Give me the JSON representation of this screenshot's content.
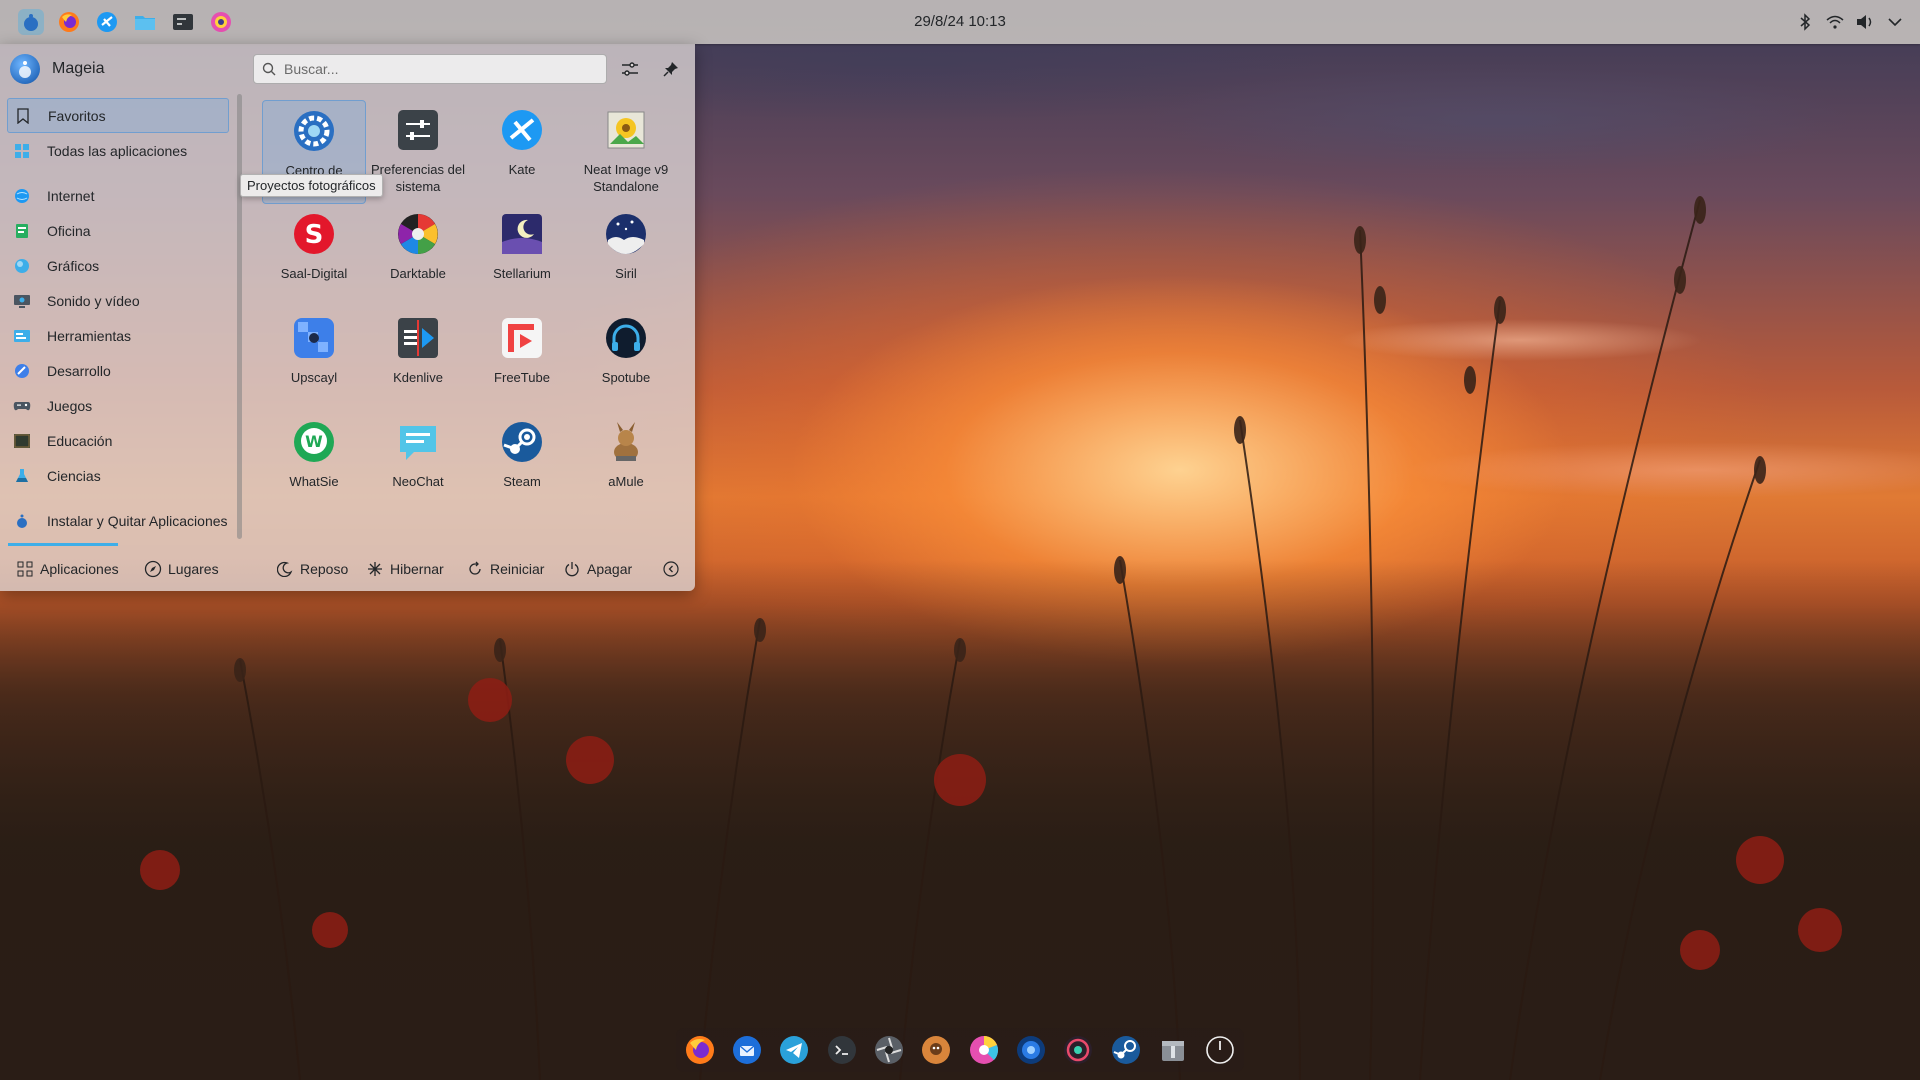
{
  "top_panel": {
    "clock": "29/8/24 10:13",
    "launchers": [
      "mageia-icon",
      "firefox-icon",
      "kate-icon",
      "folder-icon",
      "terminal-icon",
      "darktable-icon"
    ],
    "tray": [
      "bluetooth-icon",
      "wifi-icon",
      "volume-icon",
      "chevron-down-icon"
    ]
  },
  "menu": {
    "user_name": "Mageia",
    "search_placeholder": "Buscar...",
    "sidebar": [
      {
        "label": "Favoritos",
        "active": true
      },
      {
        "label": "Todas las aplicaciones"
      },
      {
        "label": "Internet"
      },
      {
        "label": "Oficina"
      },
      {
        "label": "Gráficos"
      },
      {
        "label": "Sonido y vídeo"
      },
      {
        "label": "Herramientas"
      },
      {
        "label": "Desarrollo"
      },
      {
        "label": "Juegos"
      },
      {
        "label": "Educación"
      },
      {
        "label": "Ciencias"
      },
      {
        "label": "Instalar y Quitar Aplicaciones"
      }
    ],
    "apps": [
      {
        "label": "Centro de",
        "icon": "gear-icon",
        "selected": true
      },
      {
        "label": "Preferencias del sistema",
        "icon": "settings-sliders-icon"
      },
      {
        "label": "Kate",
        "icon": "kate-icon"
      },
      {
        "label": "Neat Image v9 Standalone",
        "icon": "neat-image-icon"
      },
      {
        "label": "Saal-Digital",
        "icon": "saal-digital-icon"
      },
      {
        "label": "Darktable",
        "icon": "darktable-icon"
      },
      {
        "label": "Stellarium",
        "icon": "stellarium-icon"
      },
      {
        "label": "Siril",
        "icon": "siril-icon"
      },
      {
        "label": "Upscayl",
        "icon": "upscayl-icon"
      },
      {
        "label": "Kdenlive",
        "icon": "kdenlive-icon"
      },
      {
        "label": "FreeTube",
        "icon": "freetube-icon"
      },
      {
        "label": "Spotube",
        "icon": "spotube-icon"
      },
      {
        "label": "WhatSie",
        "icon": "whatsie-icon"
      },
      {
        "label": "NeoChat",
        "icon": "neochat-icon"
      },
      {
        "label": "Steam",
        "icon": "steam-icon"
      },
      {
        "label": "aMule",
        "icon": "amule-icon"
      }
    ],
    "tooltip": "Proyectos fotográficos",
    "footer": {
      "aplicaciones": "Aplicaciones",
      "lugares": "Lugares",
      "reposo": "Reposo",
      "hibernar": "Hibernar",
      "reiniciar": "Reiniciar",
      "apagar": "Apagar"
    }
  },
  "dock": [
    "firefox-icon",
    "thunderbird-icon",
    "telegram-icon",
    "terminal-icon",
    "aperture-icon",
    "amule-icon",
    "darktable-icon",
    "browser-icon",
    "obs-icon",
    "steam-icon",
    "archive-icon",
    "power-icon"
  ],
  "colors": {
    "accent": "#3daee9",
    "panel": "#d2cdc8",
    "text": "#232629"
  }
}
